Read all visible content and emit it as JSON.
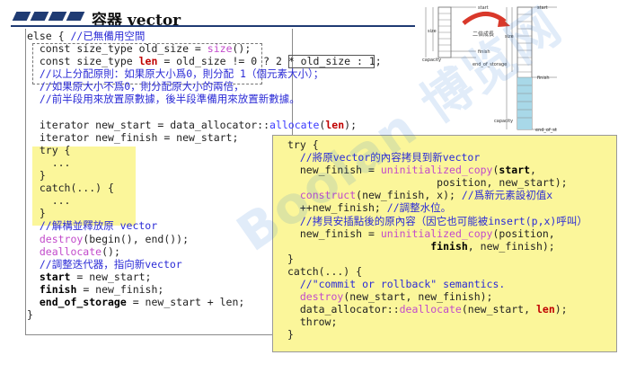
{
  "header": {
    "title": "容器 vector"
  },
  "main_code": [
    [
      {
        "t": "else { ",
        "c": "t"
      },
      {
        "t": "//已無備用空間",
        "c": "cmt"
      }
    ],
    [
      {
        "t": "  const size_type old_size = ",
        "c": "t"
      },
      {
        "t": "size",
        "c": "fn"
      },
      {
        "t": "();",
        "c": "t"
      }
    ],
    [
      {
        "t": "  const size_type ",
        "c": "t"
      },
      {
        "t": "len",
        "c": "hl"
      },
      {
        "t": " = old_size != 0 ? ",
        "c": "t"
      },
      {
        "t": "2 * old_size",
        "c": "t"
      },
      {
        "t": " : 1;",
        "c": "t"
      }
    ],
    [
      {
        "t": "  //以上分配原則：如果原大小爲0，則分配 1（個元素大小）；",
        "c": "cmt"
      }
    ],
    [
      {
        "t": "  //如果原大小不爲0，則分配原大小的兩倍，",
        "c": "cmt"
      }
    ],
    [
      {
        "t": "  //前半段用來放置原數據，後半段準備用來放置新數據。",
        "c": "cmt"
      }
    ],
    [
      {
        "t": "",
        "c": "t"
      }
    ],
    [
      {
        "t": "  iterator new_start = data_allocator::",
        "c": "t"
      },
      {
        "t": "allocate",
        "c": "kw"
      },
      {
        "t": "(",
        "c": "t"
      },
      {
        "t": "len",
        "c": "hl"
      },
      {
        "t": ");",
        "c": "t"
      }
    ],
    [
      {
        "t": "  iterator new_finish = new_start;",
        "c": "t"
      }
    ],
    [
      {
        "t": "  try {",
        "c": "t"
      }
    ],
    [
      {
        "t": "    ...",
        "c": "t"
      }
    ],
    [
      {
        "t": "  }",
        "c": "t"
      }
    ],
    [
      {
        "t": "  catch(...) {",
        "c": "t"
      }
    ],
    [
      {
        "t": "    ...",
        "c": "t"
      }
    ],
    [
      {
        "t": "  }",
        "c": "t"
      }
    ],
    [
      {
        "t": "  //解構並釋放原 vector",
        "c": "cmt"
      }
    ],
    [
      {
        "t": "  destroy",
        "c": "fn"
      },
      {
        "t": "(begin(), end());",
        "c": "t"
      }
    ],
    [
      {
        "t": "  deallocate",
        "c": "fn"
      },
      {
        "t": "();",
        "c": "t"
      }
    ],
    [
      {
        "t": "  //調整迭代器，指向新vector",
        "c": "cmt"
      }
    ],
    [
      {
        "t": "  start",
        "c": "b"
      },
      {
        "t": " = new_start;",
        "c": "t"
      }
    ],
    [
      {
        "t": "  finish",
        "c": "b"
      },
      {
        "t": " = new_finish;",
        "c": "t"
      }
    ],
    [
      {
        "t": "  end_of_storage",
        "c": "b"
      },
      {
        "t": " = new_start + len;",
        "c": "t"
      }
    ],
    [
      {
        "t": "}",
        "c": "t"
      }
    ]
  ],
  "popup_code": [
    [
      {
        "t": "try {",
        "c": "t"
      }
    ],
    [
      {
        "t": "  //將原vector的內容拷貝到新vector",
        "c": "cmt"
      }
    ],
    [
      {
        "t": "  new_finish = ",
        "c": "t"
      },
      {
        "t": "uninitialized_copy",
        "c": "fn"
      },
      {
        "t": "(",
        "c": "t"
      },
      {
        "t": "start",
        "c": "b"
      },
      {
        "t": ",",
        "c": "t"
      }
    ],
    [
      {
        "t": "                        position, new_start);",
        "c": "t"
      }
    ],
    [
      {
        "t": "  construct",
        "c": "fn"
      },
      {
        "t": "(new_finish, x); ",
        "c": "t"
      },
      {
        "t": "//爲新元素設初值x",
        "c": "cmt"
      }
    ],
    [
      {
        "t": "  ++new_finish; ",
        "c": "t"
      },
      {
        "t": "//調整水位。",
        "c": "cmt"
      }
    ],
    [
      {
        "t": "  //拷貝安插點後的原內容（因它也可能被insert(p,x)呼叫）",
        "c": "cmt"
      }
    ],
    [
      {
        "t": "  new_finish = ",
        "c": "t"
      },
      {
        "t": "uninitialized_copy",
        "c": "fn"
      },
      {
        "t": "(position,",
        "c": "t"
      }
    ],
    [
      {
        "t": "                       ",
        "c": "t"
      },
      {
        "t": "finish",
        "c": "b"
      },
      {
        "t": ", new_finish);",
        "c": "t"
      }
    ],
    [
      {
        "t": "}",
        "c": "t"
      }
    ],
    [
      {
        "t": "catch(...) {",
        "c": "t"
      }
    ],
    [
      {
        "t": "  //\"commit or rollback\" semantics.",
        "c": "cmt"
      }
    ],
    [
      {
        "t": "  destroy",
        "c": "fn"
      },
      {
        "t": "(new_start, new_finish);",
        "c": "t"
      }
    ],
    [
      {
        "t": "  data_allocator::",
        "c": "t"
      },
      {
        "t": "deallocate",
        "c": "fn"
      },
      {
        "t": "(new_start, ",
        "c": "t"
      },
      {
        "t": "len",
        "c": "hl"
      },
      {
        "t": ");",
        "c": "t"
      }
    ],
    [
      {
        "t": "  throw;",
        "c": "t"
      }
    ],
    [
      {
        "t": "}",
        "c": "t"
      }
    ]
  ],
  "diagram": {
    "old_labels": {
      "start": "start",
      "size": "size",
      "finish": "finish",
      "capacity": "capacity",
      "end_of_storage": "end_of_storage"
    },
    "arrow_label": "二倍成長",
    "new_labels": {
      "start": "start",
      "size": "size",
      "finish": "finish",
      "capacity": "capacity",
      "end_of_storage": "end_of_st"
    }
  },
  "watermark": "Boolan 博览网",
  "colors": {
    "comment": "#2b2bd6",
    "function": "#c24acb",
    "highlight": "#c00000",
    "popup_bg": "#fbf69a",
    "header_bar": "#1f3b73",
    "cell_fill": "#a8d8e8",
    "arrow": "#d9382a"
  }
}
